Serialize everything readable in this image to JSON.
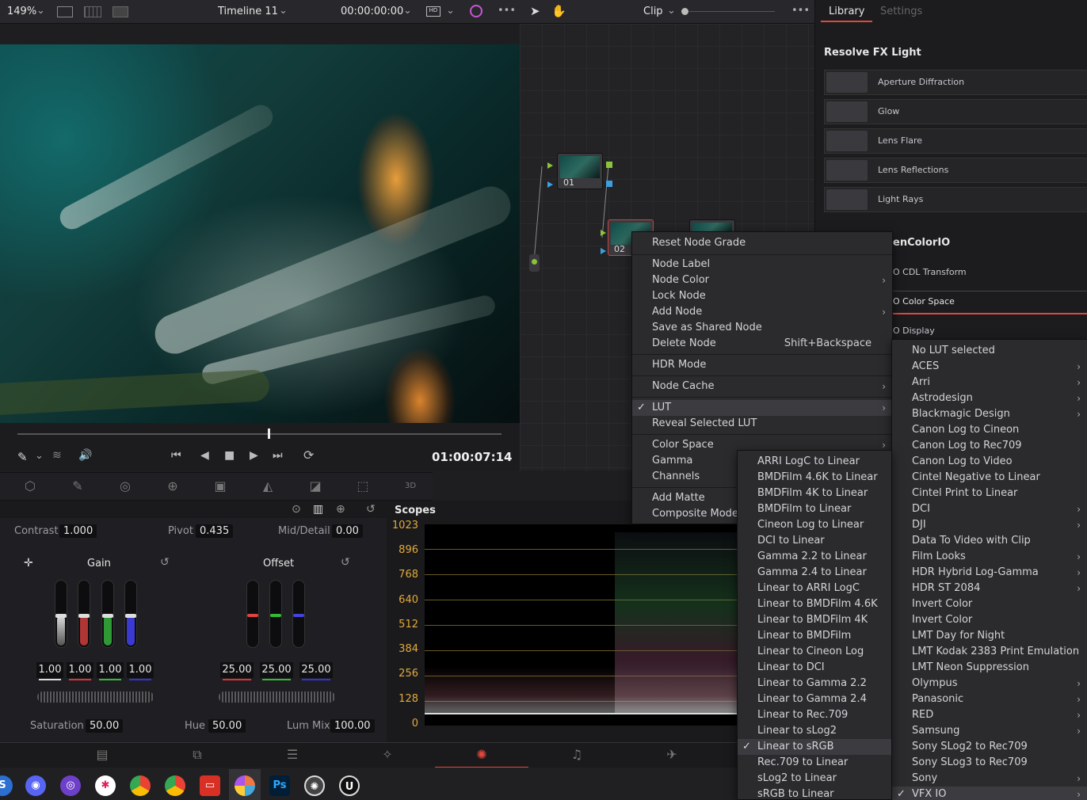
{
  "topbar": {
    "zoom": "149%",
    "timeline": "Timeline 11",
    "timecode": "00:00:00:00",
    "clip_label": "Clip",
    "more": "•••"
  },
  "library": {
    "tab_library": "Library",
    "tab_settings": "Settings",
    "section1": "Resolve FX Light",
    "fx": [
      "Aperture Diffraction",
      "Glow",
      "Lens Flare",
      "Lens Reflections",
      "Light Rays"
    ],
    "section2": "enColorIO",
    "ocio": [
      "O CDL Transform",
      "O Color Space",
      "O Display"
    ]
  },
  "transport": {
    "timecode": "01:00:07:14"
  },
  "primaries": {
    "contrast_label": "Contrast",
    "contrast": "1.000",
    "pivot_label": "Pivot",
    "pivot": "0.435",
    "middetail_label": "Mid/Detail",
    "middetail": "0.00",
    "gain_label": "Gain",
    "offset_label": "Offset",
    "gain_vals": [
      "1.00",
      "1.00",
      "1.00",
      "1.00"
    ],
    "offset_vals": [
      "25.00",
      "25.00",
      "25.00"
    ],
    "saturation_label": "Saturation",
    "saturation": "50.00",
    "hue_label": "Hue",
    "hue": "50.00",
    "lummix_label": "Lum Mix",
    "lummix": "100.00"
  },
  "scopes": {
    "title": "Scopes",
    "y_ticks": [
      "1023",
      "896",
      "768",
      "640",
      "512",
      "384",
      "256",
      "128",
      "0"
    ]
  },
  "nodes": {
    "n1": "01",
    "n2": "02"
  },
  "context_menu": {
    "items": [
      "Reset Node Grade",
      "Node Label",
      "Node Color",
      "Lock Node",
      "Add Node",
      "Save as Shared Node",
      "Delete Node",
      "HDR Mode",
      "Node Cache",
      "LUT",
      "Reveal Selected LUT",
      "Color Space",
      "Gamma",
      "Channels",
      "Add Matte",
      "Composite Mode"
    ],
    "shortcut_delete": "Shift+Backspace"
  },
  "lut_submenu": {
    "items": [
      "No LUT selected",
      "ACES",
      "Arri",
      "Astrodesign",
      "Blackmagic Design",
      "Canon Log to Cineon",
      "Canon Log to Rec709",
      "Canon Log to Video",
      "Cintel Negative to Linear",
      "Cintel Print to Linear",
      "DCI",
      "DJI",
      "Data To Video with Clip",
      "Film Looks",
      "HDR Hybrid Log-Gamma",
      "HDR ST 2084",
      "Invert Color",
      "Invert Color",
      "LMT Day for Night",
      "LMT Kodak 2383 Print Emulation",
      "LMT Neon Suppression",
      "Olympus",
      "Panasonic",
      "RED",
      "Samsung",
      "Sony SLog2 to Rec709",
      "Sony SLog3 to Rec709",
      "Sony",
      "VFX IO"
    ]
  },
  "vfxio_submenu": {
    "items": [
      "ARRI LogC to Linear",
      "BMDFilm 4.6K to Linear",
      "BMDFilm 4K to Linear",
      "BMDFilm to Linear",
      "Cineon Log to Linear",
      "DCI to Linear",
      "Gamma 2.2 to Linear",
      "Gamma 2.4 to Linear",
      "Linear to ARRI LogC",
      "Linear to BMDFilm 4.6K",
      "Linear to BMDFilm 4K",
      "Linear to BMDFilm",
      "Linear to Cineon Log",
      "Linear to DCI",
      "Linear to Gamma 2.2",
      "Linear to Gamma 2.4",
      "Linear to Rec.709",
      "Linear to sLog2",
      "Linear to sRGB",
      "Rec.709 to Linear",
      "sLog2 to Linear",
      "sRGB to Linear"
    ]
  },
  "taskbar": {
    "ps": "Ps"
  },
  "colors": {
    "accent": "#e2473b",
    "scope_label": "#e2a93b"
  }
}
